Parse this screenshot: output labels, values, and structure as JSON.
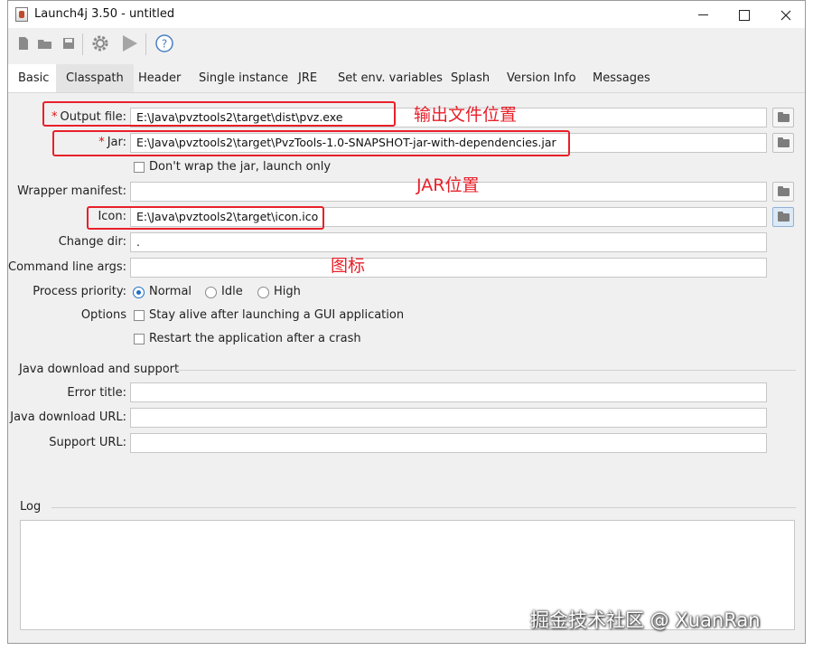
{
  "window": {
    "title": "Launch4j 3.50 - untitled"
  },
  "toolbar": {
    "icons": [
      "new-file-icon",
      "open-folder-icon",
      "save-icon",
      "settings-gear-icon",
      "run-play-icon",
      "help-icon"
    ],
    "help_glyph": "?"
  },
  "tabs": [
    "Basic",
    "Classpath",
    "Header",
    "Single instance",
    "JRE",
    "Set env. variables",
    "Splash",
    "Version Info",
    "Messages"
  ],
  "active_tab": "Basic",
  "form": {
    "output_file": {
      "label": "Output file:",
      "required": "*",
      "value": "E:\\Java\\pvztools2\\target\\dist\\pvz.exe"
    },
    "jar": {
      "label": "Jar:",
      "required": "*",
      "value": "E:\\Java\\pvztools2\\target\\PvzTools-1.0-SNAPSHOT-jar-with-dependencies.jar"
    },
    "dont_wrap": {
      "label": "Don't wrap the jar, launch only",
      "checked": false
    },
    "wrapper_manifest": {
      "label": "Wrapper manifest:",
      "value": ""
    },
    "icon": {
      "label": "Icon:",
      "value": "E:\\Java\\pvztools2\\target\\icon.ico"
    },
    "change_dir": {
      "label": "Change dir:",
      "value": "."
    },
    "cmd_args": {
      "label": "Command line args:",
      "value": ""
    },
    "priority": {
      "label": "Process priority:",
      "options": [
        "Normal",
        "Idle",
        "High"
      ],
      "selected": "Normal"
    },
    "options": {
      "label": "Options",
      "stay_alive": {
        "label": "Stay alive after launching a GUI application",
        "checked": false
      },
      "restart": {
        "label": "Restart the application after a crash",
        "checked": false
      }
    }
  },
  "java_download": {
    "section": "Java download and support",
    "error_title": {
      "label": "Error title:",
      "value": ""
    },
    "download_url": {
      "label": "Java download URL:",
      "value": ""
    },
    "support_url": {
      "label": "Support URL:",
      "value": ""
    }
  },
  "log": {
    "section": "Log",
    "content": ""
  },
  "annotations": {
    "output_position": "输出文件位置",
    "jar_position": "JAR位置",
    "icon": "图标",
    "color": "#e8202a"
  },
  "watermark": "掘金技术社区 @ XuanRan"
}
